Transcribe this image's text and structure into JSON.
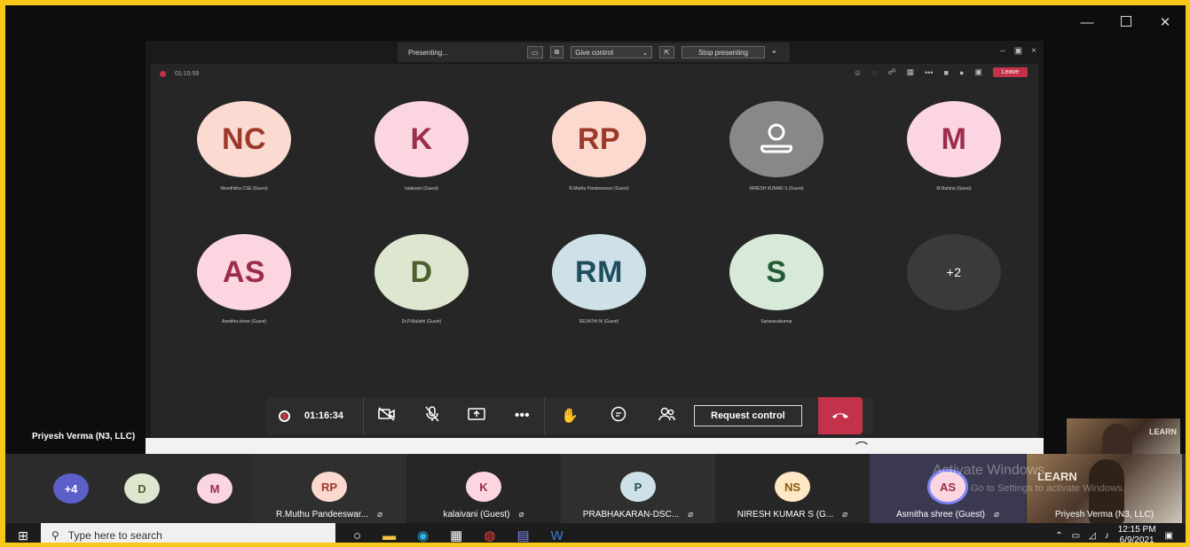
{
  "window_controls": {
    "minimize": "—",
    "maximize": "",
    "close": "✕"
  },
  "presenting_bar": {
    "status": "Presenting...",
    "give_control": "Give control",
    "stop_presenting": "Stop presenting"
  },
  "meeting_header": {
    "timer": "01:15:59",
    "leave": "Leave"
  },
  "grid_participants": [
    {
      "initials": "NC",
      "name": "Nivedhitha CSE (Guest)",
      "bg": "#fbdbd1",
      "fg": "#9b3a2a"
    },
    {
      "initials": "K",
      "name": "kalaivani (Guest)",
      "bg": "#fbd5df",
      "fg": "#9c2d4a"
    },
    {
      "initials": "RP",
      "name": "R.Muthu Pandeeswari (Guest)",
      "bg": "#fbd9cf",
      "fg": "#9b3a2a"
    },
    {
      "initials": "",
      "name": "NIRESH KUMAR S (Guest)",
      "bg": "#8a8886",
      "fg": "#ffffff"
    },
    {
      "initials": "M",
      "name": "M.Bahina (Guest)",
      "bg": "#fbd5e2",
      "fg": "#9c2d4a"
    },
    {
      "initials": "AS",
      "name": "Asmitha shree (Guest)",
      "bg": "#fbd5df",
      "fg": "#9c2d4a"
    },
    {
      "initials": "D",
      "name": "Dr.P.Malathi (Guest)",
      "bg": "#dde6cf",
      "fg": "#4b5e2b"
    },
    {
      "initials": "RM",
      "name": "REVATHI M (Guest)",
      "bg": "#cfe1e8",
      "fg": "#1f4e5f"
    },
    {
      "initials": "S",
      "name": "Saravanakumar",
      "bg": "#d7ead9",
      "fg": "#235a33"
    },
    {
      "initials": "+2",
      "name": "",
      "bg": "#3b3a39",
      "fg": "#ffffff"
    }
  ],
  "call_controls": {
    "timer": "01:16:34",
    "request_control": "Request control"
  },
  "presenter": {
    "name": "Priyesh Verma (N3, LLC)",
    "backdrop_text": "LEARN"
  },
  "strip": [
    {
      "initials": "+4",
      "bg": "#5b5fc7",
      "fg": "#ffffff",
      "name": ""
    },
    {
      "initials": "D",
      "bg": "#dde6cf",
      "fg": "#4b5e2b",
      "name": ""
    },
    {
      "initials": "M",
      "bg": "#fbd5e2",
      "fg": "#9c2d4a",
      "name": ""
    },
    {
      "initials": "RP",
      "bg": "#fbd9cf",
      "fg": "#9b3a2a",
      "name": "R.Muthu Pandeeswar..."
    },
    {
      "initials": "K",
      "bg": "#fbd5df",
      "fg": "#9c2d4a",
      "name": "kalaivani (Guest)"
    },
    {
      "initials": "P",
      "bg": "#cfe1e8",
      "fg": "#1f4e5f",
      "name": "PRABHAKARAN-DSC..."
    },
    {
      "initials": "NS",
      "bg": "#fde7c4",
      "fg": "#8a5a10",
      "name": "NIRESH KUMAR S (G..."
    },
    {
      "initials": "AS",
      "bg": "#fbd5df",
      "fg": "#9c2d4a",
      "name": "Asmitha shree (Guest)"
    }
  ],
  "self_tile": {
    "name": "Priyesh Verma (N3, LLC)",
    "backdrop_text": "LEARN"
  },
  "watermark": {
    "line1": "Activate Windows",
    "line2": "Go to Settings to activate Windows."
  },
  "taskbar": {
    "search_placeholder": "Type here to search",
    "time": "12:15 PM",
    "date": "6/9/2021"
  }
}
